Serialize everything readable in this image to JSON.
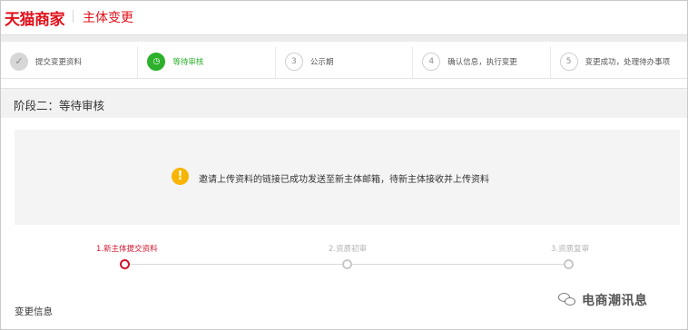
{
  "header": {
    "logo": "天猫商家",
    "title": "主体变更"
  },
  "steps": [
    {
      "index": "✓",
      "label": "提交变更资料",
      "state": "done"
    },
    {
      "index": "◷",
      "label": "等待审核",
      "state": "active"
    },
    {
      "index": "3",
      "label": "公示期",
      "state": "pending"
    },
    {
      "index": "4",
      "label": "确认信息，执行变更",
      "state": "pending"
    },
    {
      "index": "5",
      "label": "变更成功，处理待办事项",
      "state": "pending"
    }
  ],
  "stage": {
    "title": "阶段二：等待审核"
  },
  "notice": {
    "icon": "!",
    "text": "邀请上传资料的链接已成功发送至新主体邮箱，待新主体接收并上传资料"
  },
  "progress": [
    {
      "label": "1.新主体提交资料",
      "state": "active"
    },
    {
      "label": "2.资质初审",
      "state": "pending"
    },
    {
      "label": "3.资质复审",
      "state": "pending"
    }
  ],
  "section": {
    "change_info": "变更信息"
  },
  "watermark": {
    "text": "电商潮讯息",
    "icon": "wechat-icon"
  },
  "colors": {
    "brand_red": "#e0111b",
    "active_green": "#2db12d",
    "progress_red": "#d0142c",
    "warning": "#f7b500"
  }
}
